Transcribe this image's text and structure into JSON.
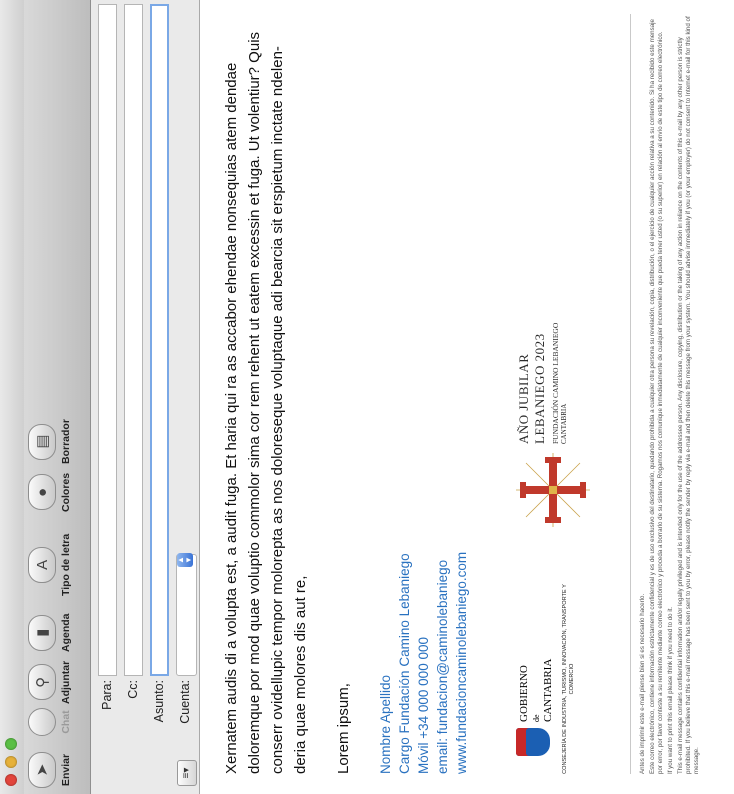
{
  "toolbar": {
    "send": "Enviar",
    "chat": "Chat",
    "attach": "Adjuntar",
    "agenda": "Agenda",
    "font": "Tipo de letra",
    "colors": "Colores",
    "draft": "Borrador"
  },
  "header": {
    "to_label": "Para:",
    "cc_label": "Cc:",
    "subject_label": "Asunto:",
    "account_label": "Cuenta:"
  },
  "body": {
    "paragraph": "Xernatem audis di a volupta est, a audit fuga. Et haria qui ra as accabor ehendae nonsequias atem dendae doloremque por mod quae voluptio commolor sima cor rem rehent ut eatem excessin et fuga. Ut volentiur? Quis conserr ovidellupic tempor molorepta as nos doloreseque voluptaque adi bearcia sit erspietum inctate ndelen-deria quae molores dis aut re,",
    "closing": "Lorem ipsum,"
  },
  "signature": {
    "name": "Nombre Apellido",
    "role": "Cargo Fundación Camino Lebaniego",
    "phone": "Móvil +34 000 000 000",
    "email": "email: fundacion@caminolebaniego",
    "web": "www.fundacioncaminolebaniego.com"
  },
  "logos": {
    "gob_line1": "GOBIERNO",
    "gob_de": "de",
    "gob_line2": "CANTABRIA",
    "consejeria": "CONSEJERÍA DE INDUSTRIA, TURISMO, INNOVACIÓN, TRANSPORTE Y COMERCIO",
    "ajl_line1": "AÑO JUBILAR",
    "ajl_line2": "LEBANIEGO 2023",
    "ajl_line3": "FUNDACIÓN CAMINO LEBANIEGO",
    "ajl_line4": "CANTABRIA"
  },
  "disclaimer": {
    "es1": "Antes de imprimir este e-mail piense bien si es necesario hacerlo.",
    "es2": "Este correo electrónico, contiene información estrictamente confidencial y es de uso exclusivo del destinatario, quedando prohibida a cualquier otra persona su revelación, copia, distribución, o el ejercicio de cualquier acción relativa a su contenido. Si ha recibido este mensaje por error, por favor conteste a su remitente mediante correo electrónico y proceda a borrarlo de su sistema. Rogamos nos comunique inmediatamente de cualquier inconveniente que pueda tener usted (o su superior) en relación al envío de este tipo de correo electrónico.",
    "en1": "If you want to print this email please think if you need to do it.",
    "en2": "This e-mail message contains confidential information and/or legally privileged and is intended only for the use of the addressee person. Any disclosure, copying, distribution or the taking of any action in reliance on the contents of this e-mail by any other person is strictly prohibited. If you believe that this e-mail message has been sent to you by error, please notify the sender by reply via e-mail and then delete this message from your system. You should advise immediately if you (or your employer) do not consent to Internet e-mail for this kind of message."
  }
}
